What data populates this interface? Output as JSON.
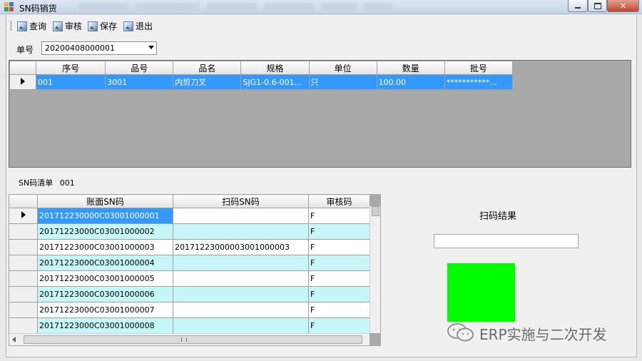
{
  "window": {
    "title": "SN码销货",
    "blurred_tabs": [
      "",
      "",
      "",
      "",
      "",
      ""
    ]
  },
  "toolbar": {
    "query": "查询",
    "audit": "审核",
    "save": "保存",
    "exit": "退出"
  },
  "order": {
    "label": "单号",
    "value": "20200408000001"
  },
  "items": {
    "columns": [
      "序号",
      "品号",
      "品名",
      "规格",
      "单位",
      "数量",
      "批号"
    ],
    "rows": [
      {
        "seq": "001",
        "code": "3001",
        "name": "内剪刀叉",
        "spec": "SJG1-0.6-001...",
        "unit": "只",
        "qty": "100.00",
        "batch": "***********..."
      }
    ]
  },
  "sn_list": {
    "label": "SN码清单",
    "value": "001",
    "columns": [
      "账面SN码",
      "扫码SN码",
      "审核码"
    ],
    "rows": [
      {
        "book": "201712230000C03001000001",
        "scan": "",
        "audit": "F"
      },
      {
        "book": "20171223000C03001000002",
        "scan": "",
        "audit": "F"
      },
      {
        "book": "20171223000C03001000003",
        "scan": "20171223000003001000003",
        "audit": "F"
      },
      {
        "book": "20171223000C03001000004",
        "scan": "",
        "audit": "F"
      },
      {
        "book": "20171223000C03001000005",
        "scan": "",
        "audit": "F"
      },
      {
        "book": "20171223000C03001000006",
        "scan": "",
        "audit": "F"
      },
      {
        "book": "20171223000C03001000007",
        "scan": "",
        "audit": "F"
      },
      {
        "book": "20171223000C03001000008",
        "scan": "",
        "audit": "F"
      }
    ]
  },
  "scan": {
    "title": "扫码结果",
    "input_value": "",
    "result_color": "#00ff00"
  },
  "watermark": {
    "text": "ERP实施与二次开发"
  },
  "colors": {
    "selection": "#3399ff",
    "alt_row": "#c6f6f7"
  }
}
